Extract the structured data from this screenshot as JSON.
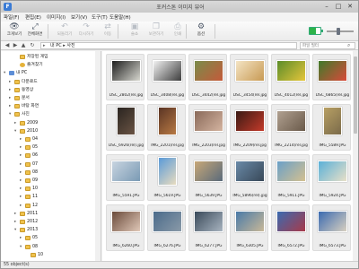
{
  "window": {
    "title": "포커스톤 이미지 뷰어",
    "app_icon": "F"
  },
  "menu": [
    "파일(F)",
    "편집(E)",
    "이미지(I)",
    "보기(V)",
    "도구(T)",
    "도움말(H)"
  ],
  "toolbar": [
    {
      "label": "크게보기",
      "icon": "eye-icon",
      "glyph": "👁",
      "enabled": true
    },
    {
      "label": "전체화면",
      "icon": "fullscreen-icon",
      "glyph": "⤢",
      "enabled": true
    },
    {
      "label": "되돌리기",
      "icon": "rotate-left-icon",
      "glyph": "↶",
      "enabled": false
    },
    {
      "label": "다시하기",
      "icon": "rotate-right-icon",
      "glyph": "↷",
      "enabled": false
    },
    {
      "label": "이동",
      "icon": "move-icon",
      "glyph": "⇄",
      "enabled": false
    },
    {
      "label": "슬쇼",
      "icon": "slideshow-icon",
      "glyph": "▣",
      "enabled": false
    },
    {
      "label": "보관하기",
      "icon": "copy-icon",
      "glyph": "❐",
      "enabled": false
    },
    {
      "label": "인쇄",
      "icon": "print-icon",
      "glyph": "⎙",
      "enabled": false
    },
    {
      "label": "옵션",
      "icon": "gear-icon",
      "glyph": "⚙",
      "enabled": true
    }
  ],
  "address": {
    "path": "내 PC ▸ 사진",
    "search_placeholder": "파일 필터"
  },
  "tree": [
    {
      "label": "저장된 게임",
      "icon": "folder",
      "level": 2,
      "exp": ""
    },
    {
      "label": "즐겨찾기",
      "icon": "star",
      "level": 2,
      "exp": ""
    },
    {
      "label": "내 PC",
      "icon": "pc",
      "level": 0,
      "exp": "▾"
    },
    {
      "label": "다운로드",
      "icon": "folder",
      "level": 1,
      "exp": "▸"
    },
    {
      "label": "동영상",
      "icon": "folder",
      "level": 1,
      "exp": "▸"
    },
    {
      "label": "문서",
      "icon": "folder",
      "level": 1,
      "exp": "▸"
    },
    {
      "label": "바탕 화면",
      "icon": "folder",
      "level": 1,
      "exp": "▸"
    },
    {
      "label": "사진",
      "icon": "folder",
      "level": 1,
      "exp": "▾"
    },
    {
      "label": "2009",
      "icon": "folder",
      "level": 2,
      "exp": "▸"
    },
    {
      "label": "2010",
      "icon": "folder",
      "level": 2,
      "exp": "▾"
    },
    {
      "label": "04",
      "icon": "folder",
      "level": 3,
      "exp": "▸"
    },
    {
      "label": "05",
      "icon": "folder",
      "level": 3,
      "exp": "▸"
    },
    {
      "label": "06",
      "icon": "folder",
      "level": 3,
      "exp": "▸"
    },
    {
      "label": "07",
      "icon": "folder",
      "level": 3,
      "exp": "▸"
    },
    {
      "label": "08",
      "icon": "folder",
      "level": 3,
      "exp": "▸"
    },
    {
      "label": "09",
      "icon": "folder",
      "level": 3,
      "exp": "▸"
    },
    {
      "label": "10",
      "icon": "folder",
      "level": 3,
      "exp": "▸"
    },
    {
      "label": "11",
      "icon": "folder",
      "level": 3,
      "exp": "▸"
    },
    {
      "label": "12",
      "icon": "folder",
      "level": 3,
      "exp": "▸"
    },
    {
      "label": "2011",
      "icon": "folder",
      "level": 2,
      "exp": "▸"
    },
    {
      "label": "2012",
      "icon": "folder",
      "level": 2,
      "exp": "▸"
    },
    {
      "label": "2013",
      "icon": "folder",
      "level": 2,
      "exp": "▾"
    },
    {
      "label": "05",
      "icon": "folder",
      "level": 3,
      "exp": "▸"
    },
    {
      "label": "08",
      "icon": "folder",
      "level": 3,
      "exp": "▾"
    },
    {
      "label": "10",
      "icon": "folder",
      "level": 4,
      "exp": ""
    }
  ],
  "thumbnails": [
    {
      "caption": "DSC_2802(rel.jpg",
      "c1": "#1d1d1d",
      "c2": "#d8d8d0",
      "tall": false
    },
    {
      "caption": "DSC_3408(rel.jpg",
      "c1": "#f2f2f2",
      "c2": "#3c3c3c",
      "tall": false
    },
    {
      "caption": "DSC_3442(rel.jpg",
      "c1": "#7a8c4a",
      "c2": "#c45a3a",
      "tall": false
    },
    {
      "caption": "DSC_3454(rel.jpg",
      "c1": "#f4e4c4",
      "c2": "#c89a54",
      "tall": false
    },
    {
      "caption": "DSC_4012(rel.jpg",
      "c1": "#5b8d2a",
      "c2": "#e5c53a",
      "tall": false
    },
    {
      "caption": "DSC_6865(rel.jpg",
      "c1": "#3f7a2a",
      "c2": "#d84a3a",
      "tall": false
    },
    {
      "caption": "DSC_6926(rel).jpg",
      "c1": "#2a2420",
      "c2": "#6a5444",
      "tall": true
    },
    {
      "caption": "IMG_2201(rel.jpg",
      "c1": "#5a3424",
      "c2": "#b87a44",
      "tall": true
    },
    {
      "caption": "IMG_2203(rel.jpg",
      "c1": "#8a6a5a",
      "c2": "#d4b4a0",
      "tall": false
    },
    {
      "caption": "IMG_2209(rel.jpg",
      "c1": "#3a1a14",
      "c2": "#c43a2a",
      "tall": false
    },
    {
      "caption": "IMG_2214(rel.jpg",
      "c1": "#b0a090",
      "c2": "#6a5a4a",
      "tall": false
    },
    {
      "caption": "IMG_5589.JPG",
      "c1": "#b8a064",
      "c2": "#7a6a4a",
      "tall": true
    },
    {
      "caption": "IMG_5591.JPG",
      "c1": "#c8d4e0",
      "c2": "#7a9ab4",
      "tall": false
    },
    {
      "caption": "IMG_5619.JPG",
      "c1": "#5a9ad8",
      "c2": "#e8dcc0",
      "tall": true
    },
    {
      "caption": "IMG_5639.JPG",
      "c1": "#c8a878",
      "c2": "#5a6a7a",
      "tall": false
    },
    {
      "caption": "IMG_5896(rel).jpg",
      "c1": "#6a8aa8",
      "c2": "#384858",
      "tall": false
    },
    {
      "caption": "IMG_5911.JPG",
      "c1": "#6aa0c8",
      "c2": "#d4c090",
      "tall": false
    },
    {
      "caption": "IMG_5924.JPG",
      "c1": "#5ab0d8",
      "c2": "#e8e0c8",
      "tall": false
    },
    {
      "caption": "IMG_6260.JPG",
      "c1": "#6a4a3a",
      "c2": "#e0c8b8",
      "tall": false
    },
    {
      "caption": "IMG_6276.JPG",
      "c1": "#4a6a8a",
      "c2": "#8a9aa8",
      "tall": false
    },
    {
      "caption": "IMG_6277.JPG",
      "c1": "#3a4a5a",
      "c2": "#a8b4c0",
      "tall": false
    },
    {
      "caption": "IMG_6305.JPG",
      "c1": "#4a7aa8",
      "c2": "#c8b898",
      "tall": false
    },
    {
      "caption": "IMG_6572.JPG",
      "c1": "#3a6ab0",
      "c2": "#a83a4a",
      "tall": false
    },
    {
      "caption": "IMG_6573.JPG",
      "c1": "#3a6ab0",
      "c2": "#d8d0c0",
      "tall": false
    }
  ],
  "status": {
    "text": "55 object(s)"
  }
}
